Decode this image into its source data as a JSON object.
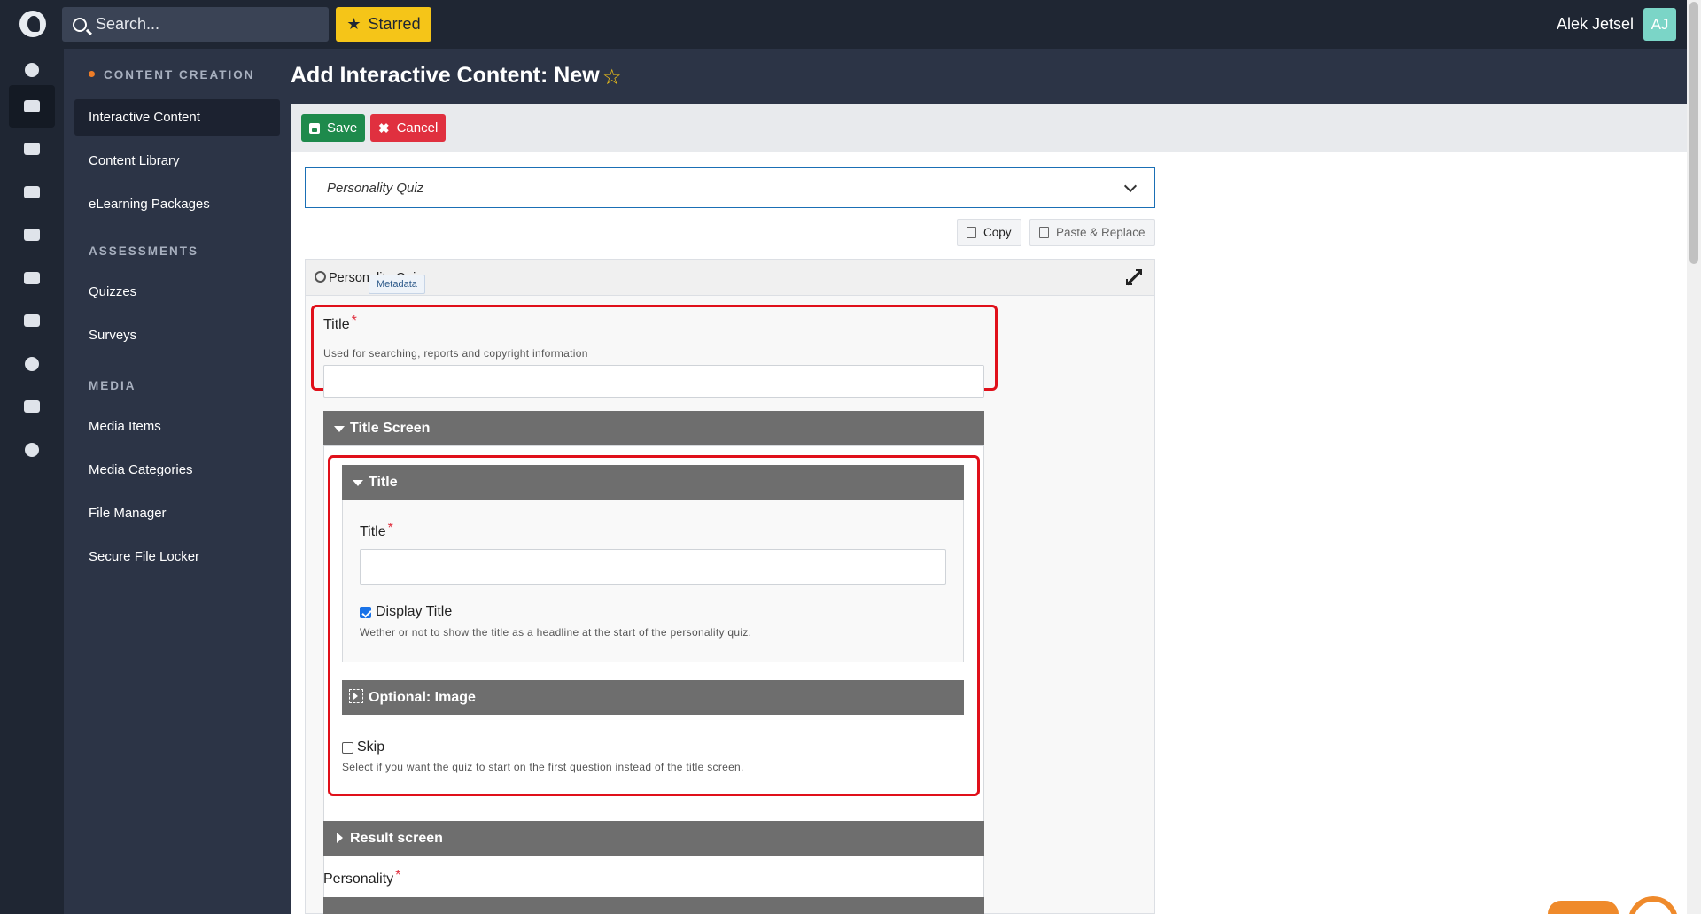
{
  "topbar": {
    "search_placeholder": "Search...",
    "starred_label": "Starred",
    "user_name": "Alek Jetsel",
    "avatar_initials": "AJ"
  },
  "rail": [
    "users",
    "content",
    "learning",
    "announcements",
    "media-money",
    "analytics",
    "chat",
    "palette",
    "window",
    "settings"
  ],
  "sidebar": {
    "sections": [
      {
        "heading": "CONTENT CREATION",
        "items": [
          "Interactive Content",
          "Content Library",
          "eLearning Packages"
        ]
      },
      {
        "heading": "ASSESSMENTS",
        "items": [
          "Quizzes",
          "Surveys"
        ]
      },
      {
        "heading": "MEDIA",
        "items": [
          "Media Items",
          "Media Categories",
          "File Manager",
          "Secure File Locker"
        ]
      }
    ],
    "active_item": "Interactive Content"
  },
  "page": {
    "title": "Add Interactive Content: New"
  },
  "toolbar": {
    "save_label": "Save",
    "cancel_label": "Cancel"
  },
  "content_type": {
    "selected": "Personality Quiz"
  },
  "actions": {
    "copy_label": "Copy",
    "paste_label": "Paste & Replace"
  },
  "panel": {
    "heading": "Personality Quiz",
    "title_field": {
      "label": "Title",
      "required_mark": "*",
      "tag": "Metadata",
      "description": "Used for searching, reports and copyright information",
      "value": ""
    },
    "title_screen": {
      "heading": "Title Screen",
      "title_group": {
        "heading": "Title",
        "field_label": "Title",
        "required_mark": "*",
        "value": "",
        "display_title_label": "Display Title",
        "display_title_checked": true,
        "display_title_desc": "Wether or not to show the title as a headline at the start of the personality quiz."
      },
      "optional_image": "Optional: Image",
      "skip_label": "Skip",
      "skip_checked": false,
      "skip_desc": "Select if you want the quiz to start on the first question instead of the title screen."
    },
    "result_screen": "Result screen",
    "personality_label": "Personality",
    "personality_required": "*"
  }
}
